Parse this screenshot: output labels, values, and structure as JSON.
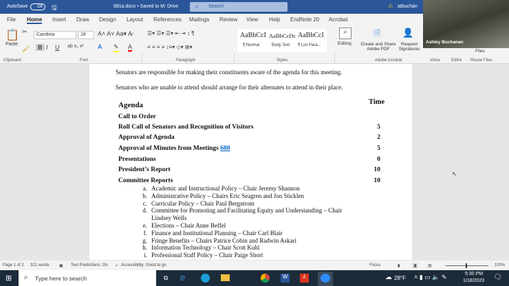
{
  "titlebar": {
    "autosave": "AutoSave",
    "toggle": "Off",
    "doc_title": "681a.docx • Saved to M: Drive",
    "search_placeholder": "Search",
    "user": "atbuchan"
  },
  "tabs": [
    "File",
    "Home",
    "Insert",
    "Draw",
    "Design",
    "Layout",
    "References",
    "Mailings",
    "Review",
    "View",
    "Help",
    "EndNote 20",
    "Acrobat"
  ],
  "active_tab": "Home",
  "ribbon": {
    "paste": "Paste",
    "font_name": "Cambria",
    "font_size": "18",
    "styles": [
      {
        "preview": "AaBbCcI",
        "label": "¶ Normal"
      },
      {
        "preview": "AaBbCcDc",
        "label": "Body Text"
      },
      {
        "preview": "AaBbCcI",
        "label": "¶ List Para..."
      }
    ],
    "editing": "Editing",
    "create_pdf": "Create and Share Adobe PDF",
    "request_sig": "Request Signatures",
    "files": "Files",
    "groups": [
      "Clipboard",
      "Font",
      "Paragraph",
      "Styles",
      "Adobe Acrobat",
      "Voice",
      "Editor",
      "Reuse Files"
    ]
  },
  "video": {
    "name": "Ashley Buchanan"
  },
  "document": {
    "p1": "Senators are responsible for making their constituents aware of the agenda for this meeting.",
    "p2": "Senators who are unable to attend should arrange for their alternates to attend in their place.",
    "agenda_heading": "Agenda",
    "time_heading": "Time",
    "items": [
      {
        "label": "Call to Order",
        "time": ""
      },
      {
        "label": "Roll Call of Senators and Recognition of Visitors",
        "time": "5"
      },
      {
        "label": "Approval of Agenda",
        "time": "2"
      },
      {
        "label": "Approval of Minutes from Meetings ",
        "link": "680",
        "time": "5"
      },
      {
        "label": "Presentations",
        "time": "0"
      },
      {
        "label": "President’s Report",
        "time": "10"
      },
      {
        "label": "Committee Reports",
        "time": "10"
      }
    ],
    "committees": [
      {
        "m": "a.",
        "t": "Academic and Instructional Policy – Chair Jeremy Shannon"
      },
      {
        "m": "b.",
        "t": "Administrative Policy – Chairs Eric Seagren and Jon Sticklen"
      },
      {
        "m": "c.",
        "t": "Curricular Policy – Chair Paul Bergstrom"
      },
      {
        "m": "d.",
        "t": "Committee for Promoting and Facilitating Equity and Understanding – Chair"
      },
      {
        "m": "",
        "t": "Lindsey Wells"
      },
      {
        "m": "e.",
        "t": "Elections – Chair Anne Beffel"
      },
      {
        "m": "f.",
        "t": "Finance and Institutional Planning – Chair Carl Blair"
      },
      {
        "m": "g.",
        "t": "Fringe Benefits – Chairs Patrice Cobin and Radwin Askari"
      },
      {
        "m": "h.",
        "t": "Information Technology – Chair Scott Kuhl"
      },
      {
        "m": "i.",
        "t": "Professional Staff Policy – Chair Paige Short"
      }
    ]
  },
  "status": {
    "page": "Page 1 of 2",
    "words": "321 words",
    "predictions": "Text Predictions: On",
    "accessibility": "Accessibility: Good to go",
    "focus": "Focus",
    "zoom": "100%",
    "zoom_level": 100
  },
  "taskbar": {
    "search": "Type here to search",
    "weather": "28°F",
    "time": "5:30 PM",
    "date": "1/18/2023"
  }
}
